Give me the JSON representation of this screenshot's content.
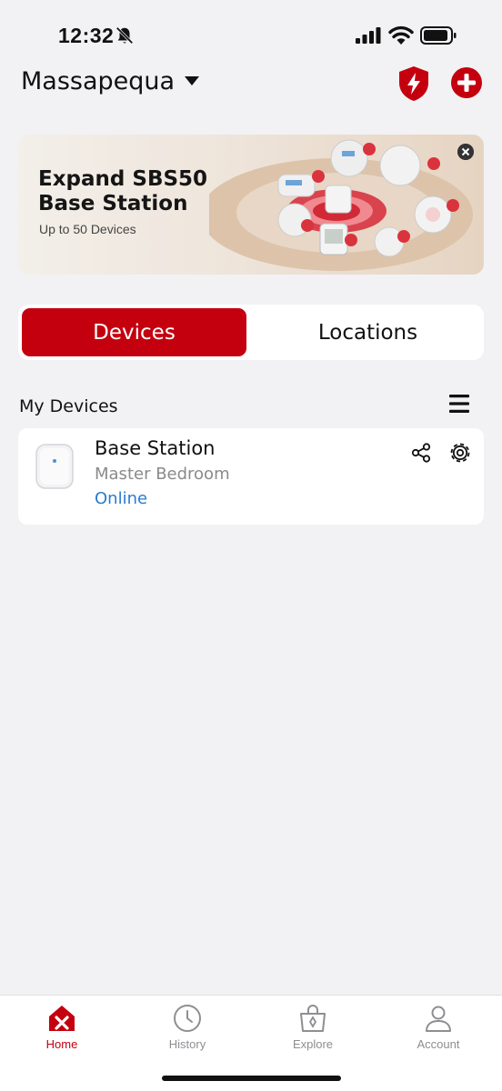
{
  "status_bar": {
    "time": "12:32"
  },
  "header": {
    "location": "Massapequa",
    "icons": {
      "caret": "chevron-down-icon",
      "shield": "shield-bolt-icon",
      "add": "plus-circle-icon"
    }
  },
  "banner": {
    "title": "Expand SBS50 Base Station",
    "subtitle": "Up to 50 Devices"
  },
  "tabs": {
    "devices": "Devices",
    "locations": "Locations",
    "active": "Devices"
  },
  "my_devices": {
    "title": "My Devices",
    "items": [
      {
        "name": "Base Station",
        "room": "Master Bedroom",
        "status": "Online"
      }
    ]
  },
  "tabbar": {
    "items": [
      {
        "label": "Home",
        "icon": "home-x-icon"
      },
      {
        "label": "History",
        "icon": "clock-icon"
      },
      {
        "label": "Explore",
        "icon": "bag-icon"
      },
      {
        "label": "Account",
        "icon": "person-icon"
      }
    ]
  },
  "colors": {
    "accent": "#c4000f",
    "link": "#2a7bd0",
    "background": "#f2f2f4"
  }
}
